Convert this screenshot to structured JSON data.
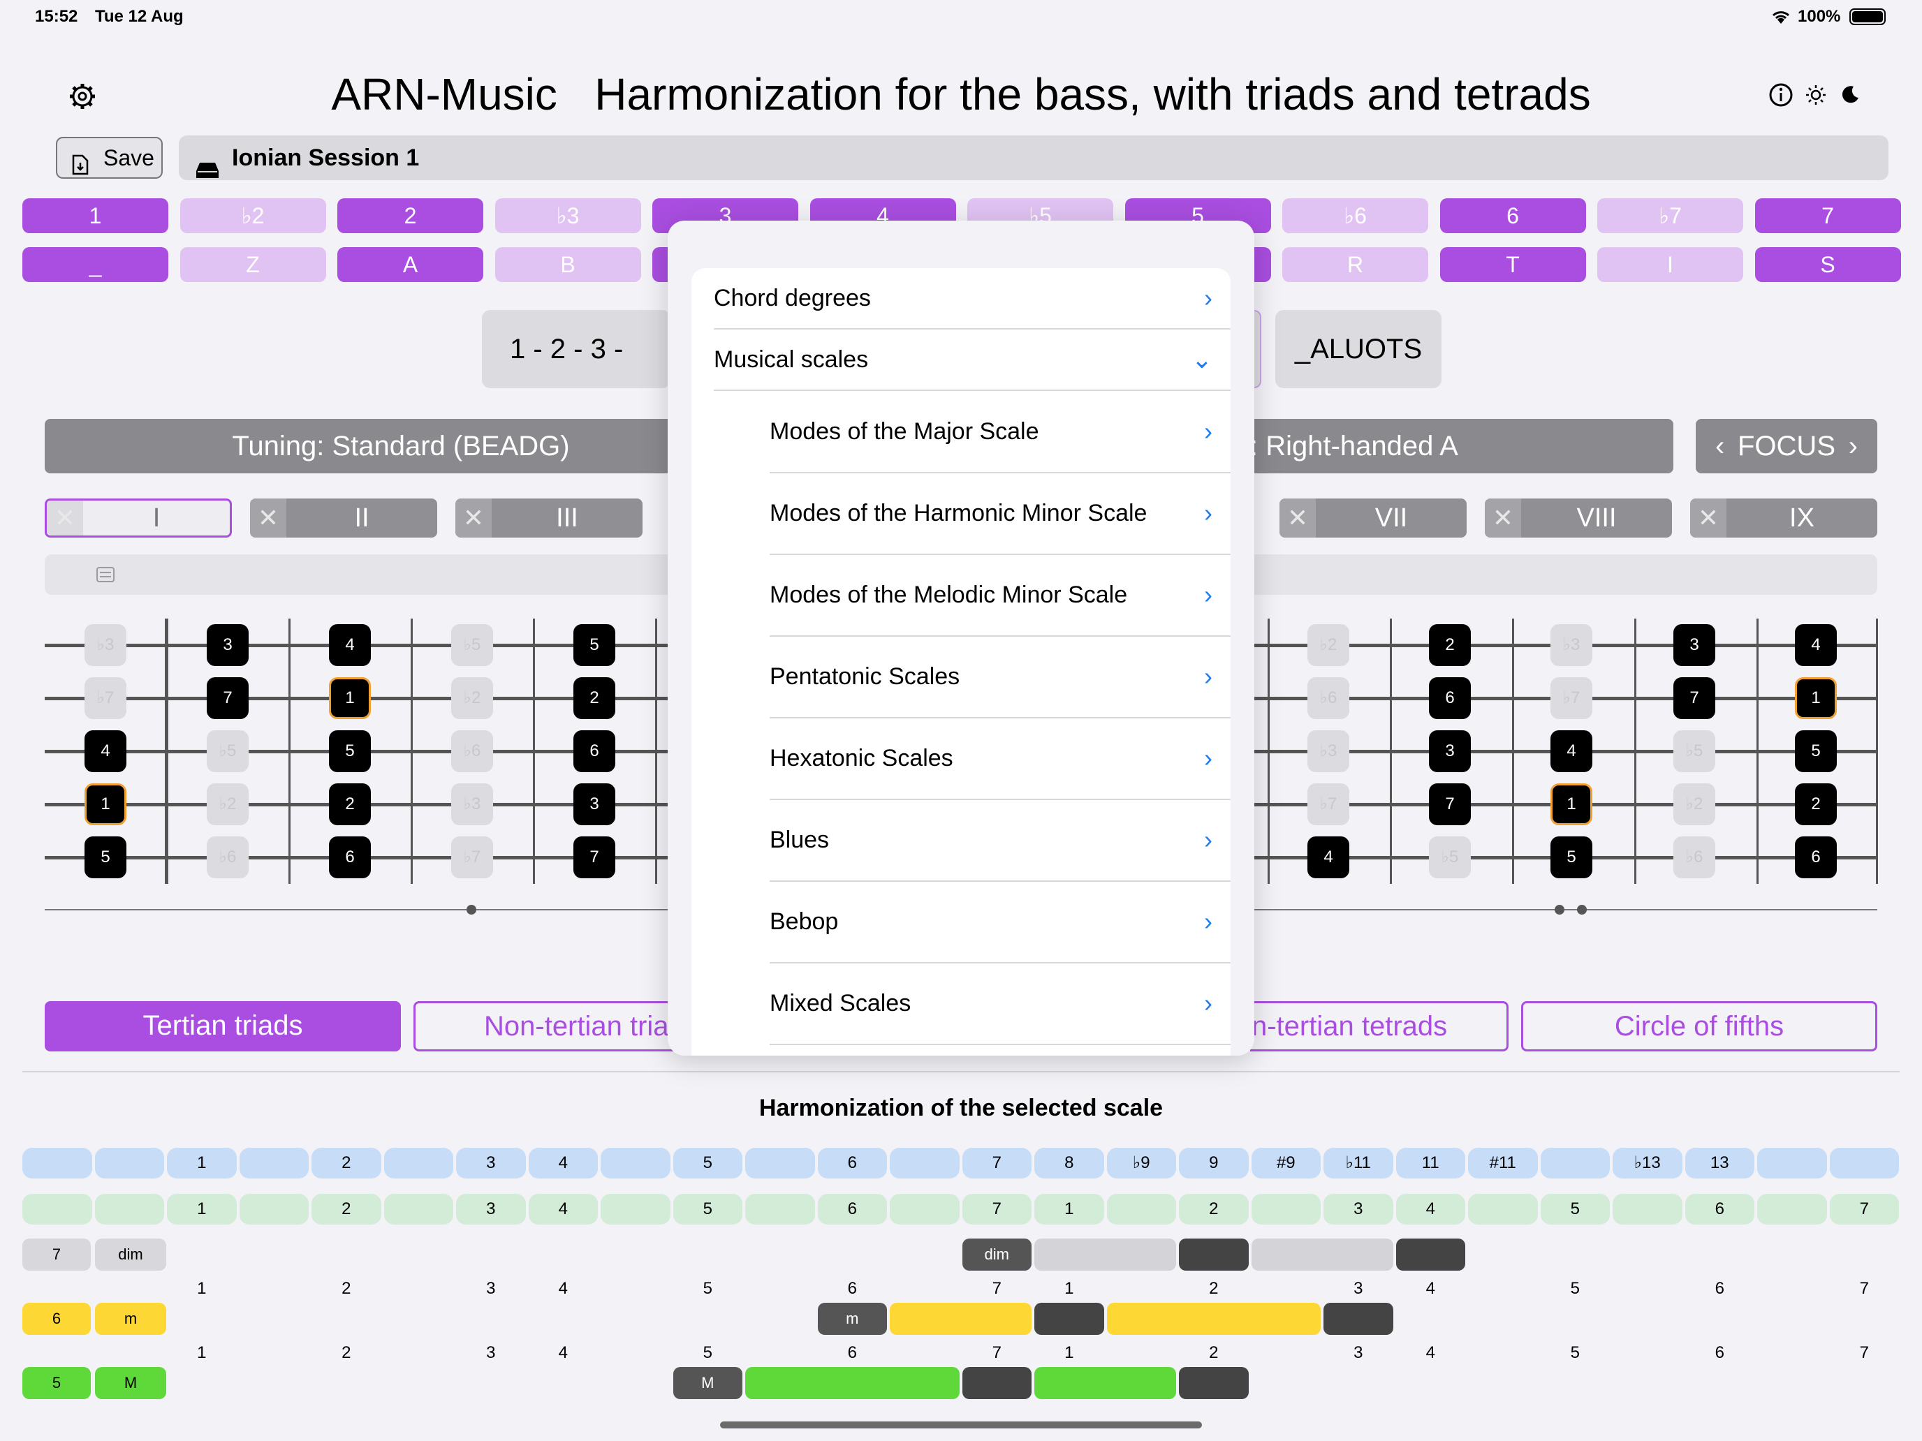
{
  "status_bar": {
    "time": "15:52",
    "date": "Tue 12 Aug",
    "battery": "100%"
  },
  "header": {
    "app_name": "ARN-Music",
    "title": "Harmonization for the bass, with triads and tetrads"
  },
  "toolbar": {
    "save_label": "Save",
    "session_name": "Ionian Session 1"
  },
  "degree_row": [
    "1",
    "♭2",
    "2",
    "♭3",
    "3",
    "4",
    "♭5",
    "5",
    "♭6",
    "6",
    "♭7",
    "7"
  ],
  "letter_row": [
    "_",
    "Z",
    "A",
    "B",
    "",
    "",
    "",
    "",
    "R",
    "T",
    "I",
    "S"
  ],
  "sequence": {
    "left": "1 - 2 - 3 -",
    "right": "_ALUOTS"
  },
  "tuning": {
    "label": "Tuning: Standard (BEADG)",
    "hand_label": ": Right-handed A",
    "focus_label": "FOCUS"
  },
  "positions": [
    "I",
    "II",
    "III",
    "VII",
    "VIII",
    "IX"
  ],
  "tabs": {
    "tertian_triads": "Tertian triads",
    "non_tertian_triads": "Non-tertian tria",
    "non_tertian_tetrads": "n-tertian tetrads",
    "circle_of_fifths": "Circle of fifths"
  },
  "harmonization": {
    "title": "Harmonization of the selected scale",
    "blue_row": [
      "",
      "",
      "1",
      "",
      "2",
      "",
      "3",
      "4",
      "",
      "5",
      "",
      "6",
      "",
      "7",
      "8",
      "♭9",
      "9",
      "#9",
      "♭11",
      "11",
      "#11",
      "",
      "♭13",
      "13",
      "",
      ""
    ],
    "green_row": [
      "",
      "",
      "1",
      "",
      "2",
      "",
      "3",
      "4",
      "",
      "5",
      "",
      "6",
      "",
      "7",
      "1",
      "",
      "2",
      "",
      "3",
      "4",
      "",
      "5",
      "",
      "6",
      "",
      "7"
    ],
    "rows": [
      {
        "degree": "7",
        "quality": "dim",
        "chip": "dim",
        "numbers": [
          "1",
          "2",
          "3",
          "4",
          "5",
          "6",
          "7",
          "1",
          "2",
          "3",
          "4",
          "5",
          "6",
          "7"
        ]
      },
      {
        "degree": "6",
        "quality": "m",
        "chip": "m",
        "numbers": [
          "1",
          "2",
          "3",
          "4",
          "5",
          "6",
          "7",
          "1",
          "2",
          "3",
          "4",
          "5",
          "6",
          "7"
        ]
      },
      {
        "degree": "5",
        "quality": "M",
        "chip": "M"
      }
    ]
  },
  "menu": {
    "chord_degrees": "Chord degrees",
    "musical_scales": "Musical scales",
    "items": [
      "Modes of the Major Scale",
      "Modes of the Harmonic Minor Scale",
      "Modes of the Melodic Minor Scale",
      "Pentatonic Scales",
      "Hexatonic Scales",
      "Blues",
      "Bebop",
      "Mixed Scales"
    ]
  },
  "fretboard_left": [
    [
      "♭3",
      "3",
      "4",
      "♭5",
      "5"
    ],
    [
      "♭7",
      "7",
      "1",
      "♭2",
      "2"
    ],
    [
      "4",
      "♭5",
      "5",
      "♭6",
      "6"
    ],
    [
      "1",
      "♭2",
      "2",
      "♭3",
      "3"
    ],
    [
      "5",
      "♭6",
      "6",
      "♭7",
      "7"
    ]
  ],
  "fretboard_right": [
    [
      "♭2",
      "2",
      "♭3",
      "3",
      "4"
    ],
    [
      "♭6",
      "6",
      "♭7",
      "7",
      "1"
    ],
    [
      "♭3",
      "3",
      "4",
      "♭5",
      "5"
    ],
    [
      "♭7",
      "7",
      "1",
      "♭2",
      "2"
    ],
    [
      "4",
      "♭5",
      "5",
      "♭6",
      "6"
    ]
  ],
  "colors": {
    "accent": "#a94ee0",
    "accent_light": "#e1c3f3",
    "yellow": "#fdd835",
    "green": "#5fd83a",
    "dark": "#444444"
  }
}
